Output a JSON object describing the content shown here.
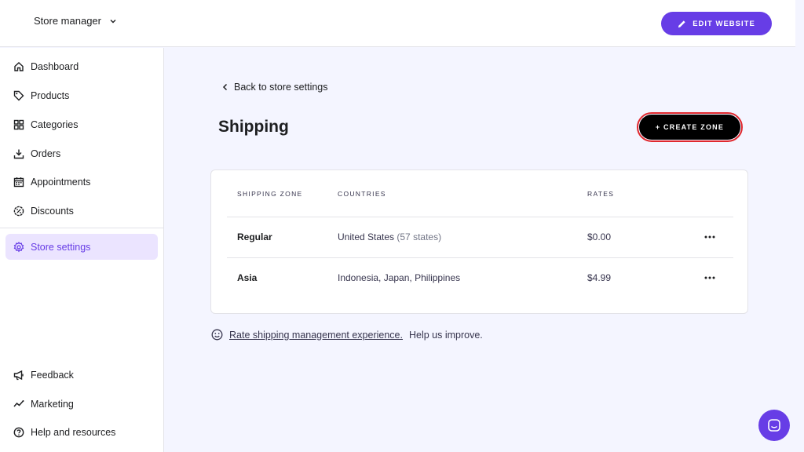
{
  "header": {
    "store_switcher": "Store manager",
    "edit_website_label": "EDIT WEBSITE"
  },
  "sidebar": {
    "items": [
      {
        "label": "Dashboard",
        "icon": "home-icon"
      },
      {
        "label": "Products",
        "icon": "tag-icon"
      },
      {
        "label": "Categories",
        "icon": "grid-icon"
      },
      {
        "label": "Orders",
        "icon": "download-icon"
      },
      {
        "label": "Appointments",
        "icon": "calendar-icon"
      },
      {
        "label": "Discounts",
        "icon": "discount-icon"
      },
      {
        "label": "Store settings",
        "icon": "gear-icon",
        "active": true
      }
    ],
    "footer_items": [
      {
        "label": "Feedback",
        "icon": "megaphone-icon"
      },
      {
        "label": "Marketing",
        "icon": "chart-icon"
      },
      {
        "label": "Help and resources",
        "icon": "help-icon"
      }
    ]
  },
  "main": {
    "back_link": "Back to store settings",
    "title": "Shipping",
    "create_zone_label": "+ CREATE ZONE",
    "table": {
      "headers": [
        "SHIPPING ZONE",
        "COUNTRIES",
        "RATES"
      ],
      "rows": [
        {
          "zone": "Regular",
          "countries": "United States",
          "countries_note": "(57 states)",
          "rate": "$0.00"
        },
        {
          "zone": "Asia",
          "countries": "Indonesia, Japan, Philippines",
          "countries_note": "",
          "rate": "$4.99"
        }
      ]
    },
    "feedback": {
      "link": "Rate shipping management experience.",
      "text": "Help us improve."
    }
  },
  "colors": {
    "primary": "#673de6",
    "active_bg": "#ebe4ff",
    "page_bg": "#f4f5ff",
    "highlight": "#e0282e"
  }
}
